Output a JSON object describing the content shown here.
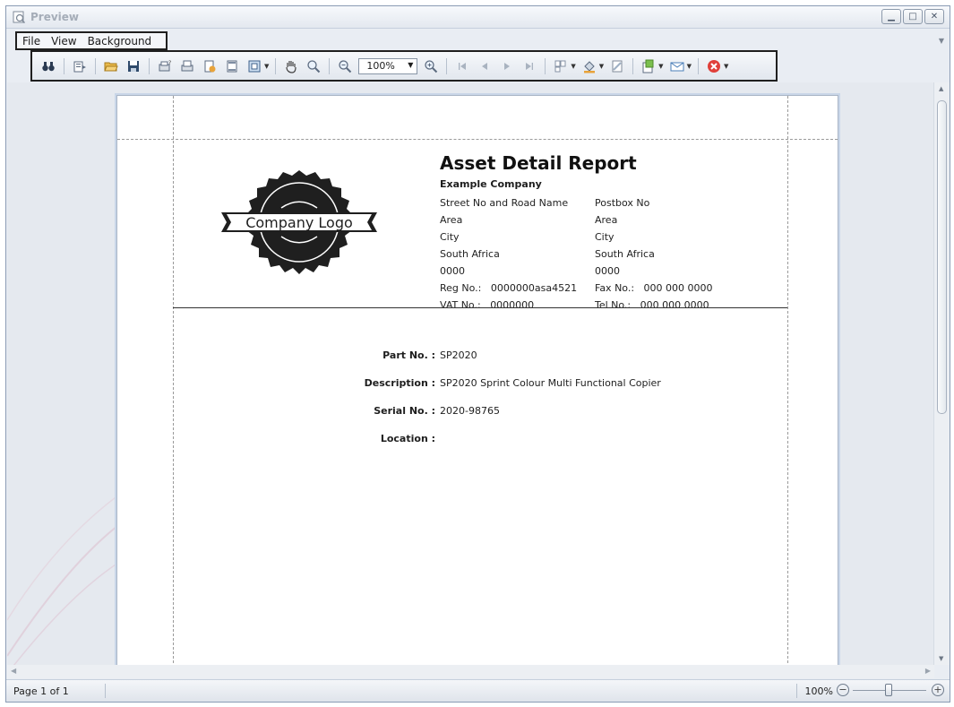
{
  "window": {
    "title": "Preview"
  },
  "menu": {
    "items": [
      "File",
      "View",
      "Background"
    ]
  },
  "toolbar": {
    "zoom_value": "100%",
    "icons": [
      "binoculars-icon",
      "document-map-icon",
      "open-icon",
      "save-icon",
      "page-setup-icon",
      "print-icon",
      "quick-print-icon",
      "header-footer-icon",
      "scale-icon",
      "hand-tool-icon",
      "magnifier-icon",
      "zoom-out-icon",
      "zoom-in-icon",
      "first-page-icon",
      "previous-page-icon",
      "next-page-icon",
      "last-page-icon",
      "multiple-pages-icon",
      "background-color-icon",
      "watermark-icon",
      "export-icon",
      "email-icon",
      "close-preview-icon"
    ]
  },
  "report": {
    "title": "Asset Detail Report",
    "company": "Example Company",
    "logo_text": "Company Logo",
    "address_left": [
      "Street No and Road Name",
      "Area",
      "City",
      "South Africa",
      "0000"
    ],
    "address_right": [
      "Postbox No",
      "Area",
      "City",
      "South Africa",
      "0000"
    ],
    "reg_label": "Reg No.:",
    "reg_value": "0000000asa4521",
    "vat_label": "VAT No.:",
    "vat_value": "0000000",
    "fax_label": "Fax No.:",
    "fax_value": "000 000 0000",
    "tel_label": "Tel No.:",
    "tel_value": "000 000 0000",
    "fields": [
      {
        "label": "Part No. :",
        "value": "SP2020"
      },
      {
        "label": "Description :",
        "value": "SP2020 Sprint Colour Multi Functional Copier"
      },
      {
        "label": "Serial No. :",
        "value": "2020-98765"
      },
      {
        "label": "Location :",
        "value": ""
      }
    ]
  },
  "status": {
    "page": "Page 1 of 1",
    "zoom": "100%"
  },
  "colors": {
    "page_border": "#c9d6e8",
    "background": "#e5e9ef",
    "logo": "#1f1f1f"
  }
}
